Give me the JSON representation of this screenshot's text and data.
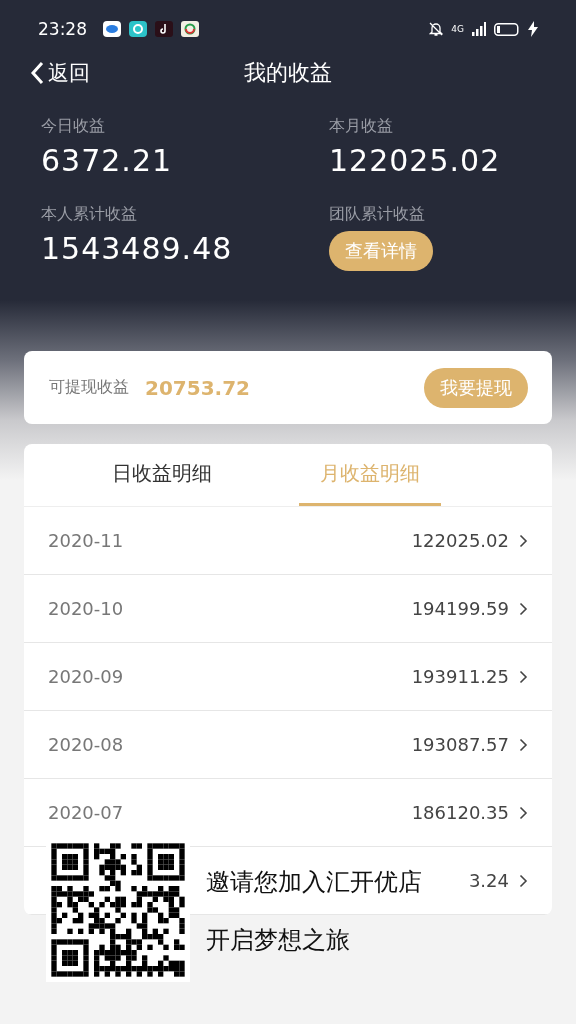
{
  "status_bar": {
    "time": "23:28",
    "network": "4G"
  },
  "nav": {
    "back": "返回",
    "title": "我的收益"
  },
  "stats": [
    {
      "label": "今日收益",
      "value": "6372.21"
    },
    {
      "label": "本月收益",
      "value": "122025.02"
    },
    {
      "label": "本人累计收益",
      "value": "1543489.48"
    },
    {
      "label": "团队累计收益",
      "button": "查看详情"
    }
  ],
  "withdraw": {
    "label": "可提现收益",
    "amount": "20753.72",
    "button": "我要提现"
  },
  "tabs": [
    {
      "label": "日收益明细",
      "selected": false
    },
    {
      "label": "月收益明细",
      "selected": true
    }
  ],
  "rows": [
    {
      "month": "2020-11",
      "value": "122025.02"
    },
    {
      "month": "2020-10",
      "value": "194199.59"
    },
    {
      "month": "2020-09",
      "value": "193911.25"
    },
    {
      "month": "2020-08",
      "value": "193087.57"
    },
    {
      "month": "2020-07",
      "value": "186120.35"
    },
    {
      "value": "3.24"
    }
  ],
  "invite": {
    "lines": [
      "邀请您加入汇开优店",
      "开启梦想之旅"
    ]
  }
}
